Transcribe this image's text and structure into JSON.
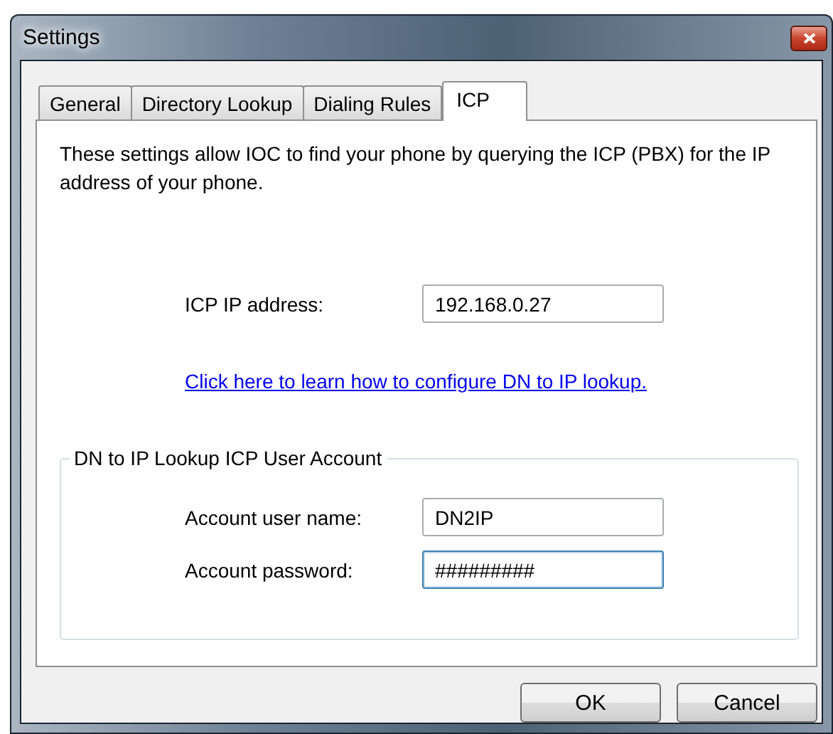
{
  "window": {
    "title": "Settings"
  },
  "tabs": [
    {
      "label": "General",
      "selected": false
    },
    {
      "label": "Directory Lookup",
      "selected": false
    },
    {
      "label": "Dialing Rules",
      "selected": false
    },
    {
      "label": "ICP",
      "selected": true
    }
  ],
  "description": "These settings allow IOC to find your phone by querying the ICP (PBX) for the IP address of your phone.",
  "ip_field": {
    "label": "ICP IP address:",
    "value": "192.168.0.27",
    "focused": false
  },
  "link": "Click here to learn how to configure DN to IP lookup.",
  "group": {
    "title": "DN to IP Lookup ICP User Account",
    "fields": [
      {
        "label": "Account user name:",
        "value": "DN2IP",
        "focused": false
      },
      {
        "label": "Account password:",
        "value": "#########",
        "focused": true
      }
    ]
  },
  "buttons": [
    {
      "label": "OK"
    },
    {
      "label": "Cancel"
    }
  ]
}
